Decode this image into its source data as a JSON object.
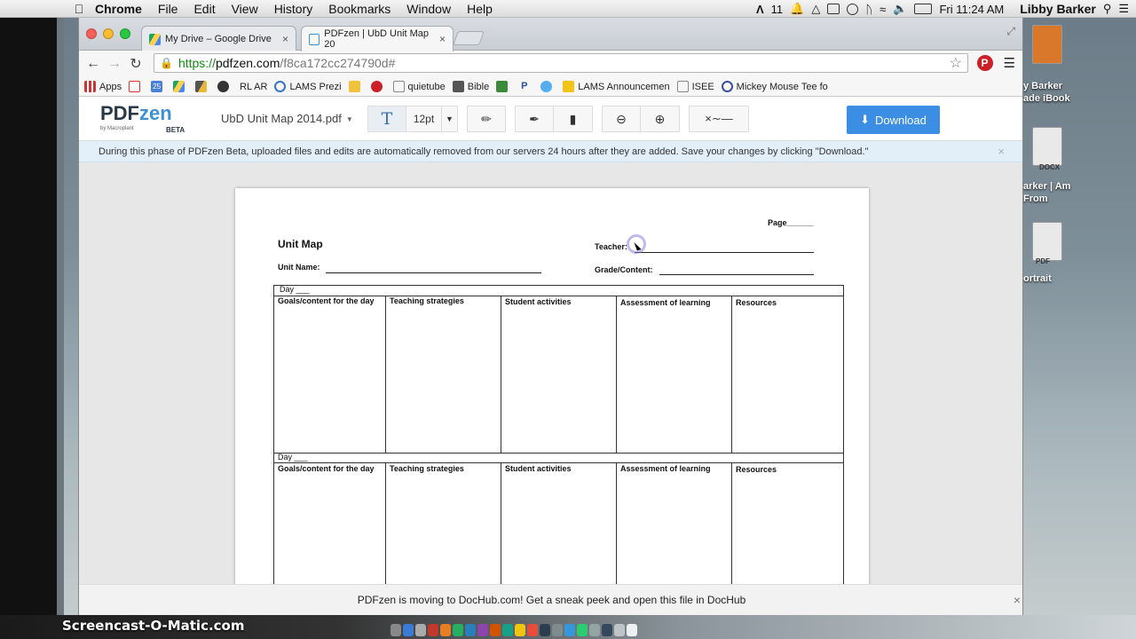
{
  "menubar": {
    "app": "Chrome",
    "items": [
      "File",
      "Edit",
      "View",
      "History",
      "Bookmarks",
      "Window",
      "Help"
    ],
    "adobe_badge": "11",
    "clock": "Fri 11:24 AM",
    "user": "Libby Barker"
  },
  "desktop": {
    "labels": [
      "y Barker",
      "ade iBook",
      "DOCX",
      "arker | Am",
      "From",
      "PDF",
      "ortrait"
    ]
  },
  "tabs": [
    {
      "label": "My Drive – Google Drive",
      "close": "×"
    },
    {
      "label": "PDFzen | UbD Unit Map 20",
      "close": "×"
    }
  ],
  "address": {
    "scheme": "https://",
    "host": "pdfzen.com",
    "path": "/f8ca172cc274790d#"
  },
  "bookmarks": [
    "Apps",
    "",
    "25",
    "",
    "",
    "",
    "RL AR",
    "LAMS Prezi",
    "",
    "",
    "quietube",
    "Bible",
    "",
    "P",
    "",
    "LAMS Announcemen",
    "ISEE",
    "Mickey Mouse Tee fo"
  ],
  "app": {
    "logo_pdf": "PDF",
    "logo_zen": "zen",
    "logo_by": "by Macroplant",
    "logo_beta": "BETA",
    "filename": "UbD Unit Map 2014.pdf",
    "text_tool": "T",
    "font_size": "12pt",
    "download_label": "Download",
    "notice": "During this phase of PDFzen Beta, uploaded files and edits are automatically removed from our servers 24 hours after they are added. Save your changes by clicking \"Download.\"",
    "banner": "PDFzen is moving to DocHub.com! Get a sneak peek and open this file in DocHub"
  },
  "document": {
    "page_label": "Page______",
    "title": "Unit Map",
    "teacher_label": "Teacher:",
    "unit_name_label": "Unit Name:",
    "grade_label": "Grade/Content:",
    "day_label": "Day ___",
    "columns": [
      "Goals/content for the day",
      "Teaching strategies",
      "Student activities",
      "Assessment of learning",
      "Resources"
    ]
  },
  "watermark": "Screencast-O-Matic.com",
  "colors": {
    "download_blue": "#3c8ee4",
    "notice_bg": "#e3eff8",
    "logo_blue": "#3d8fd6"
  }
}
